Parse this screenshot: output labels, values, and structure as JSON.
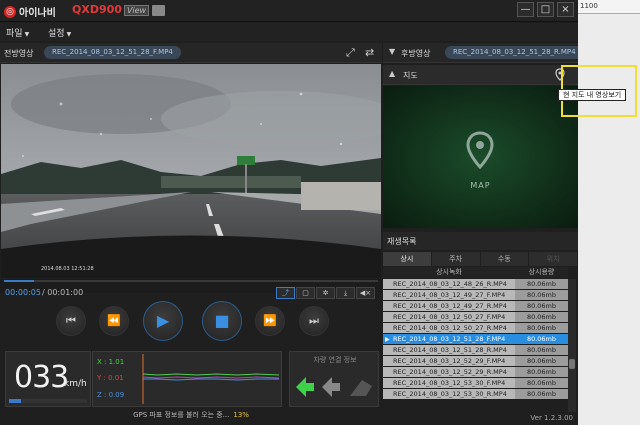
{
  "app": {
    "brand": "아이나비",
    "model": "QXD900",
    "model_suffix": "View"
  },
  "window_buttons": [
    "—",
    "□",
    "×"
  ],
  "menu": [
    {
      "label": "파일"
    },
    {
      "label": "설정"
    }
  ],
  "front": {
    "label": "전방영상",
    "file": "REC_2014_08_03_12_51_28_F.MP4"
  },
  "rear": {
    "label": "후방영상",
    "file": "REC_2014_08_03_12_51_28_R.MP4"
  },
  "video": {
    "overlay_text": "2014.08.03 12:51:28"
  },
  "playback": {
    "current": "00:00:05",
    "separator": "/",
    "total": "00:01:00",
    "progress": 0.08
  },
  "gsensor": {
    "x_label": "X : 1.01",
    "y_label": "Y : 0.01",
    "z_label": "Z : 0.09"
  },
  "speed": {
    "value": "033",
    "unit": "km/h",
    "bar_level": 0.15
  },
  "lane": {
    "title": "차량 연결 정보"
  },
  "gps_status": {
    "text": "GPS 파표 정보를 불러 오는 중...",
    "percent": "13%"
  },
  "map": {
    "title": "지도",
    "label": "MAP",
    "tooltip": "현 지도 내 영상보기"
  },
  "playlist": {
    "title": "재생목록",
    "tabs": [
      {
        "label": "상시",
        "active": true
      },
      {
        "label": "주차",
        "active": false
      },
      {
        "label": "수동",
        "active": false
      },
      {
        "label": "위치",
        "active": false,
        "disabled": true
      }
    ],
    "columns": [
      "상시녹화",
      "상시용량"
    ],
    "rows": [
      {
        "name": "REC_2014_08_03_12_48_26_R.MP4",
        "size": "80.06mb"
      },
      {
        "name": "REC_2014_08_03_12_49_27_F.MP4",
        "size": "80.06mb"
      },
      {
        "name": "REC_2014_08_03_12_49_27_R.MP4",
        "size": "80.06mb"
      },
      {
        "name": "REC_2014_08_03_12_50_27_F.MP4",
        "size": "80.06mb"
      },
      {
        "name": "REC_2014_08_03_12_50_27_R.MP4",
        "size": "80.06mb"
      },
      {
        "name": "REC_2014_08_03_12_51_28_F.MP4",
        "size": "80.06mb",
        "selected": true
      },
      {
        "name": "REC_2014_08_03_12_51_28_R.MP4",
        "size": "80.06mb"
      },
      {
        "name": "REC_2014_08_03_12_52_29_F.MP4",
        "size": "80.06mb"
      },
      {
        "name": "REC_2014_08_03_12_52_29_R.MP4",
        "size": "80.06mb"
      },
      {
        "name": "REC_2014_08_03_12_53_30_F.MP4",
        "size": "80.06mb"
      },
      {
        "name": "REC_2014_08_03_12_53_30_R.MP4",
        "size": "80.06mb"
      }
    ],
    "version": "Ver 1.2.3.00"
  },
  "desktop": {
    "ruler_text": "1100"
  }
}
